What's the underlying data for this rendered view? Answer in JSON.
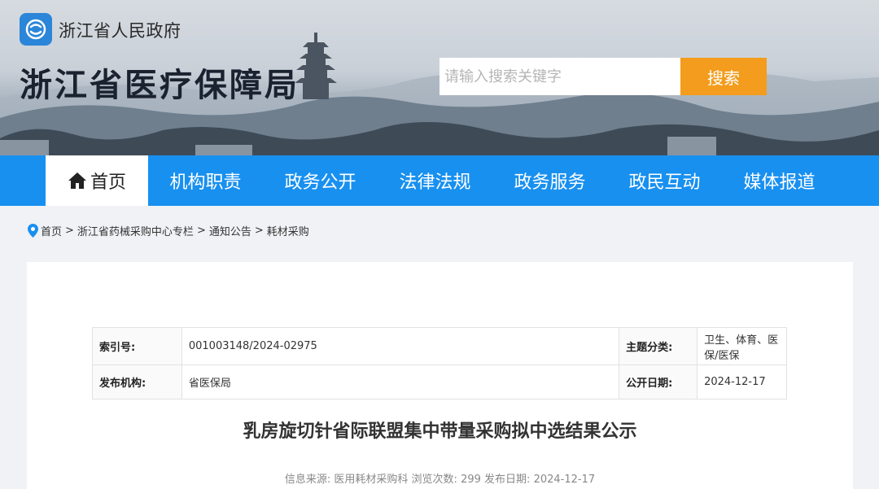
{
  "header": {
    "gov_name": "浙江省人民政府",
    "site_title": "浙江省医疗保障局",
    "search": {
      "placeholder": "请输入搜索关键字",
      "button_label": "搜索"
    }
  },
  "nav": {
    "items": [
      {
        "label": "首页",
        "active": true
      },
      {
        "label": "机构职责"
      },
      {
        "label": "政务公开"
      },
      {
        "label": "法律法规"
      },
      {
        "label": "政务服务"
      },
      {
        "label": "政民互动"
      },
      {
        "label": "媒体报道"
      }
    ]
  },
  "breadcrumb": {
    "items": [
      "首页",
      "浙江省药械采购中心专栏",
      "通知公告",
      "耗材采购"
    ],
    "separator": ">"
  },
  "meta": {
    "index_label": "索引号:",
    "index_value": "001003148/2024-02975",
    "topic_label": "主题分类:",
    "topic_value": "卫生、体育、医保/医保",
    "publisher_label": "发布机构:",
    "publisher_value": "省医保局",
    "date_label": "公开日期:",
    "date_value": "2024-12-17"
  },
  "article": {
    "title": "乳房旋切针省际联盟集中带量采购拟中选结果公示",
    "info_source_label": "信息来源:",
    "info_source": "医用耗材采购科",
    "views_label": "浏览次数:",
    "views": "299",
    "pubdate_label": "发布日期:",
    "pubdate": "2024-12-17"
  },
  "colors": {
    "nav_bg": "#1890f0",
    "search_button": "#f39c1d",
    "logo_bg": "#2b86d9"
  }
}
